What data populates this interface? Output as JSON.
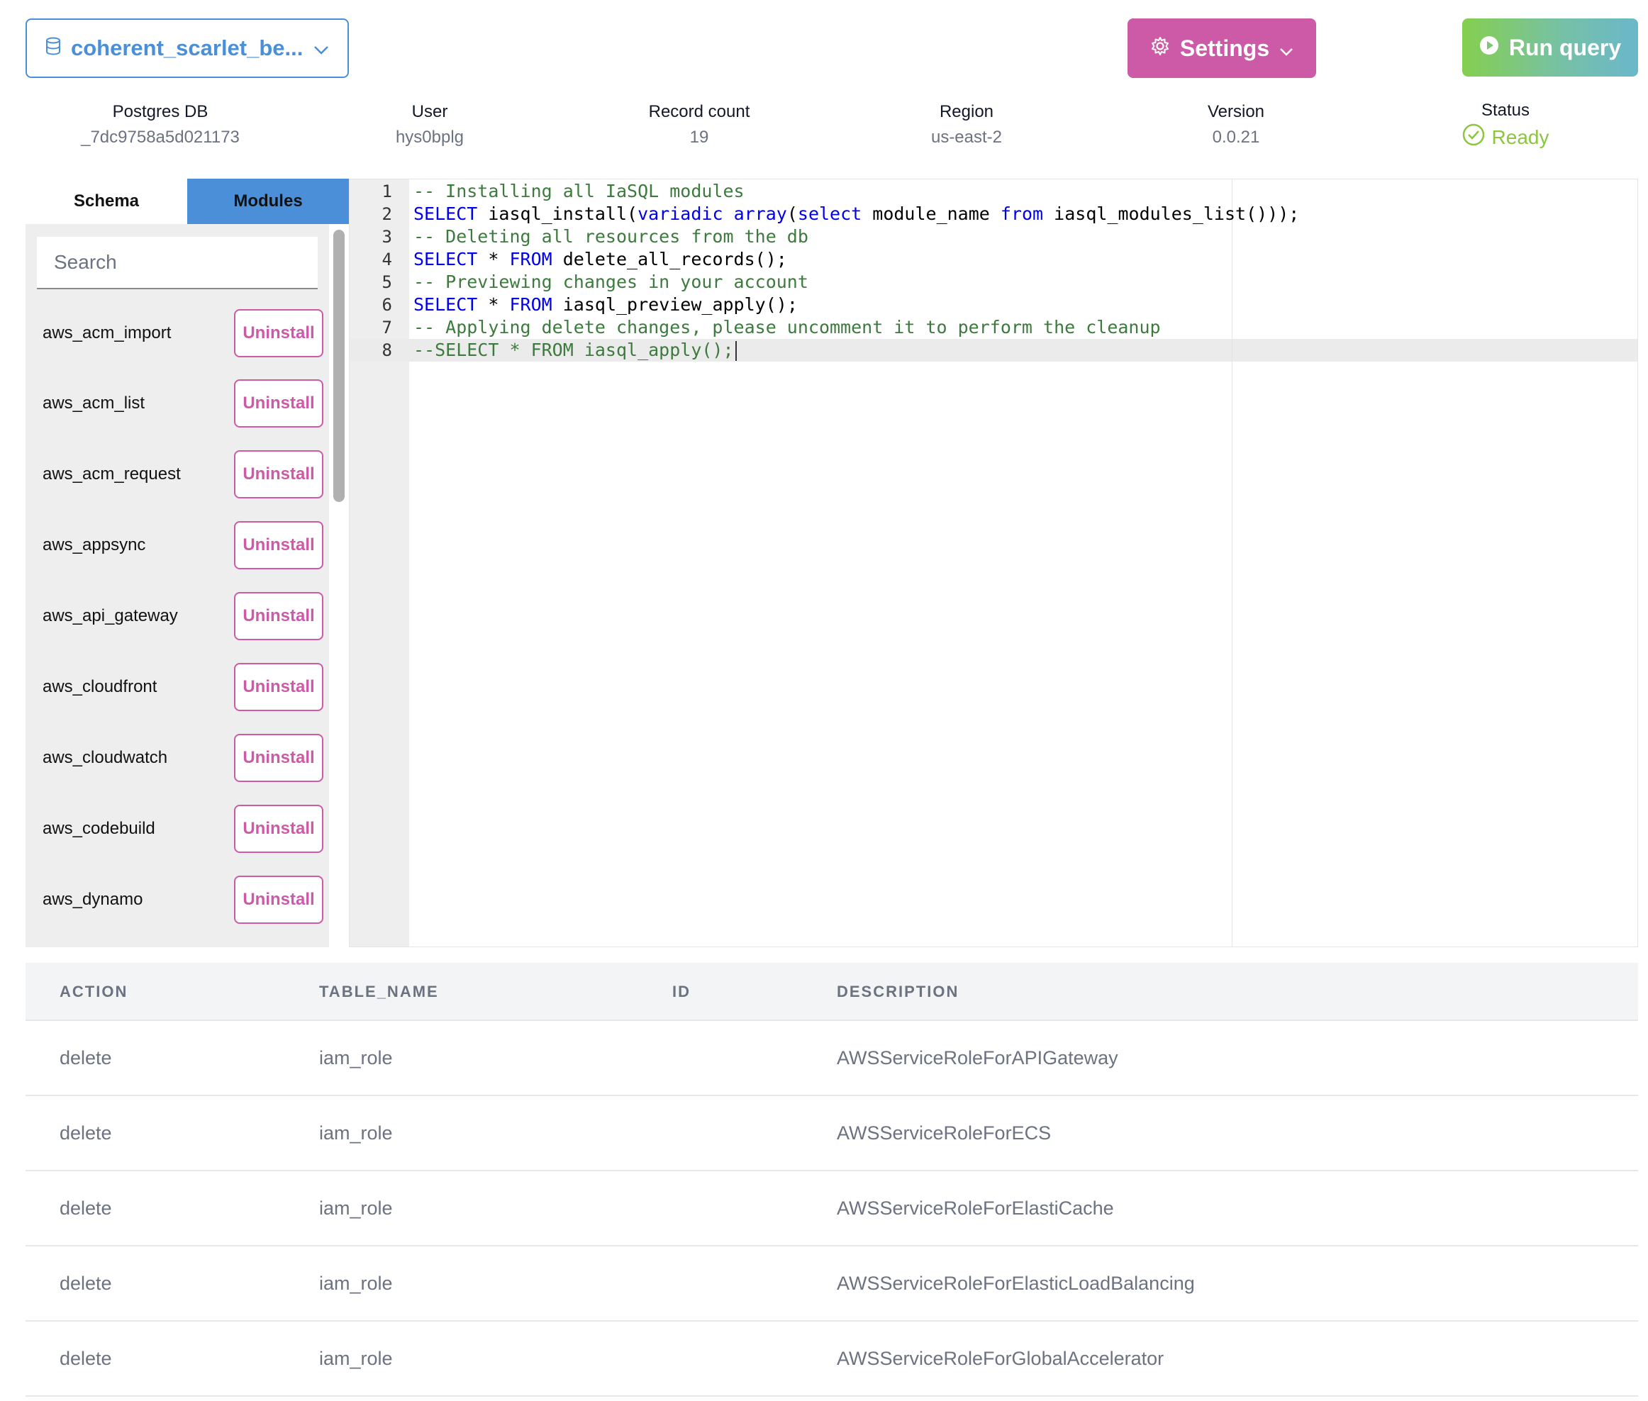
{
  "header": {
    "db_selector": {
      "label": "coherent_scarlet_be...",
      "icon": "database-icon"
    },
    "settings_label": "Settings",
    "run_label": "Run query"
  },
  "info": [
    {
      "label": "Postgres DB",
      "value": "_7dc9758a5d021173"
    },
    {
      "label": "User",
      "value": "hys0bplg"
    },
    {
      "label": "Record count",
      "value": "19"
    },
    {
      "label": "Region",
      "value": "us-east-2"
    },
    {
      "label": "Version",
      "value": "0.0.21"
    },
    {
      "label": "Status",
      "value": "Ready"
    }
  ],
  "sidebar": {
    "tabs": [
      "Schema",
      "Modules"
    ],
    "active_tab": "Modules",
    "search_placeholder": "Search",
    "action_label": "Uninstall",
    "modules": [
      "aws_acm_import",
      "aws_acm_list",
      "aws_acm_request",
      "aws_appsync",
      "aws_api_gateway",
      "aws_cloudfront",
      "aws_cloudwatch",
      "aws_codebuild",
      "aws_dynamo"
    ]
  },
  "editor": {
    "line_numbers": [
      "1",
      "2",
      "3",
      "4",
      "5",
      "6",
      "7",
      "8"
    ],
    "lines": [
      [
        {
          "t": "-- Installing all IaSQL modules",
          "c": "cm"
        }
      ],
      [
        {
          "t": "SELECT",
          "c": "kw"
        },
        {
          "t": " iasql_install(",
          "c": ""
        },
        {
          "t": "variadic",
          "c": "kw"
        },
        {
          "t": " ",
          "c": ""
        },
        {
          "t": "array",
          "c": "kw"
        },
        {
          "t": "(",
          "c": ""
        },
        {
          "t": "select",
          "c": "kw"
        },
        {
          "t": " module_name ",
          "c": ""
        },
        {
          "t": "from",
          "c": "kw"
        },
        {
          "t": " iasql_modules_list()));",
          "c": ""
        }
      ],
      [
        {
          "t": "-- Deleting all resources from the db",
          "c": "cm"
        }
      ],
      [
        {
          "t": "SELECT",
          "c": "kw"
        },
        {
          "t": " * ",
          "c": ""
        },
        {
          "t": "FROM",
          "c": "kw"
        },
        {
          "t": " delete_all_records();",
          "c": ""
        }
      ],
      [
        {
          "t": "-- Previewing changes in your account",
          "c": "cm"
        }
      ],
      [
        {
          "t": "SELECT",
          "c": "kw"
        },
        {
          "t": " * ",
          "c": ""
        },
        {
          "t": "FROM",
          "c": "kw"
        },
        {
          "t": " iasql_preview_apply();",
          "c": ""
        }
      ],
      [
        {
          "t": "-- Applying delete changes, please uncomment it to perform the cleanup",
          "c": "cm"
        }
      ],
      [
        {
          "t": "--SELECT * FROM iasql_apply();",
          "c": "cm"
        }
      ]
    ],
    "active_line": 8
  },
  "results": {
    "columns": [
      "ACTION",
      "TABLE_NAME",
      "ID",
      "DESCRIPTION"
    ],
    "rows": [
      [
        "delete",
        "iam_role",
        "",
        "AWSServiceRoleForAPIGateway"
      ],
      [
        "delete",
        "iam_role",
        "",
        "AWSServiceRoleForECS"
      ],
      [
        "delete",
        "iam_role",
        "",
        "AWSServiceRoleForElastiCache"
      ],
      [
        "delete",
        "iam_role",
        "",
        "AWSServiceRoleForElasticLoadBalancing"
      ],
      [
        "delete",
        "iam_role",
        "",
        "AWSServiceRoleForGlobalAccelerator"
      ]
    ]
  },
  "colors": {
    "primary_blue": "#4a8fd8",
    "settings_pink": "#cc5aa6",
    "status_green": "#8cc63f",
    "keyword_blue": "#0000ee",
    "comment_green": "#3d7a3d"
  }
}
